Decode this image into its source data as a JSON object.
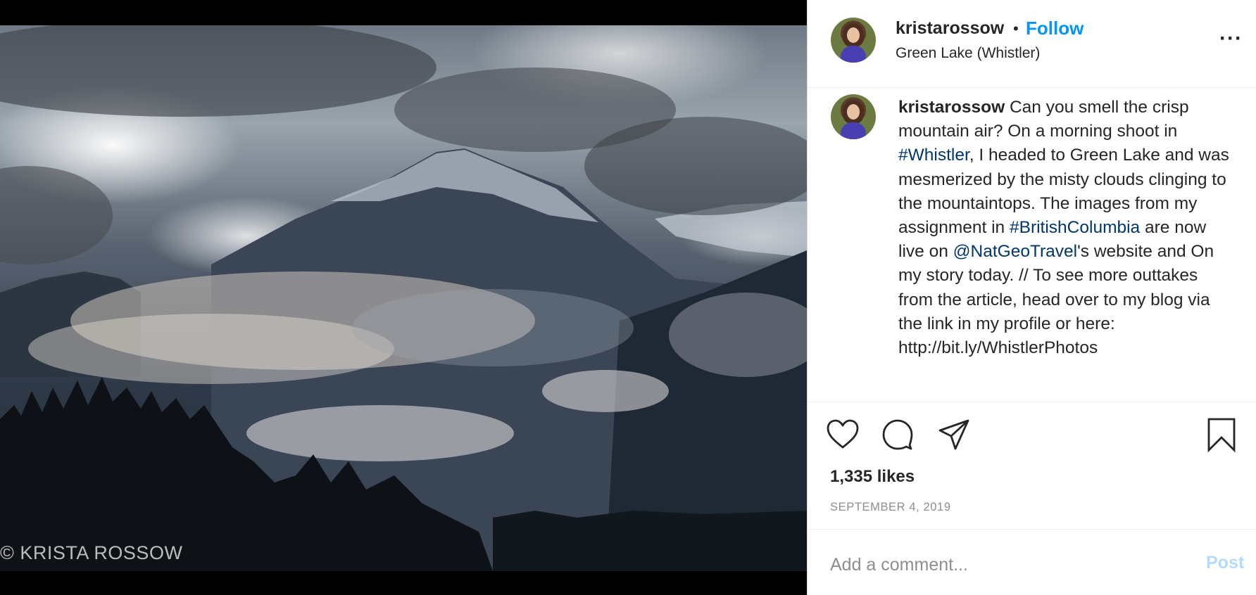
{
  "media": {
    "watermark": "© KRISTA ROSSOW"
  },
  "header": {
    "username": "kristarossow",
    "separator": "•",
    "follow_label": "Follow",
    "location": "Green Lake (Whistler)",
    "more_label": "···"
  },
  "caption": {
    "username": "kristarossow",
    "part1": " Can you smell the crisp mountain air? On a morning shoot in ",
    "tag1": "#Whistler",
    "part2": ", I headed to Green Lake and was mesmerized by the misty clouds clinging to the mountaintops. The images from my assignment in ",
    "tag2": "#BritishColumbia",
    "part3": " are now live on ",
    "tag3": "@NatGeoTravel",
    "part4": "'s website and On my story today. // To see more outtakes from the article, head over to my blog via the link in my profile or here: http://bit.ly/WhistlerPhotos"
  },
  "actions": {
    "like_icon": "heart-icon",
    "comment_icon": "comment-icon",
    "share_icon": "paper-plane-icon",
    "save_icon": "bookmark-icon"
  },
  "stats": {
    "likes": "1,335 likes",
    "date": "SEPTEMBER 4, 2019"
  },
  "comment": {
    "placeholder": "Add a comment...",
    "post_label": "Post"
  },
  "colors": {
    "link_blue": "#0095f6",
    "hashtag": "#00376b",
    "post_disabled": "#b3dbff",
    "muted": "#8e8e8e"
  }
}
